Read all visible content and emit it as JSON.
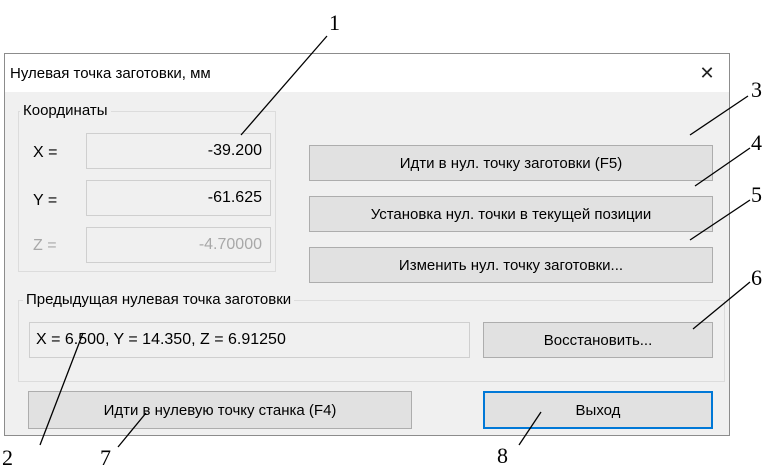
{
  "dialog": {
    "title": "Нулевая точка заготовки, мм",
    "close_glyph": "✕"
  },
  "coords": {
    "group_label": "Координаты",
    "x_label": "X =",
    "x_value": "-39.200",
    "y_label": "Y =",
    "y_value": "-61.625",
    "z_label": "Z =",
    "z_value": "-4.70000"
  },
  "buttons": {
    "go_zero": "Идти в нул. точку заготовки (F5)",
    "set_zero": "Установка нул. точки в текущей позиции",
    "change_zero": "Изменить нул. точку заготовки...",
    "restore": "Восстановить...",
    "go_machine_zero": "Идти в нулевую точку станка (F4)",
    "exit": "Выход"
  },
  "previous": {
    "group_label": "Предыдущая нулевая точка заготовки",
    "value": "X = 6.500, Y = 14.350, Z = 6.91250"
  },
  "annotations": [
    "1",
    "2",
    "3",
    "4",
    "5",
    "6",
    "7",
    "8"
  ],
  "icons": {
    "close": "close-icon"
  },
  "colors": {
    "default_button_border": "#0078d7",
    "client_bg": "#f0f0f0",
    "button_bg": "#e1e1e1"
  }
}
